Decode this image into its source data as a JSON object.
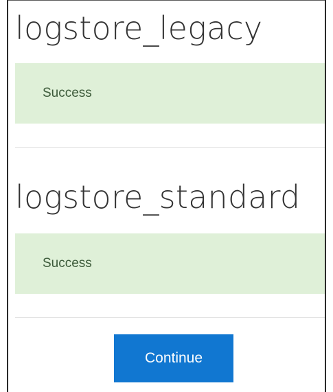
{
  "sections": [
    {
      "title": "logstore_legacy",
      "status": "Success"
    },
    {
      "title": "logstore_standard",
      "status": "Success"
    }
  ],
  "actions": {
    "continue_label": "Continue"
  },
  "colors": {
    "success_background": "#dff0d8",
    "success_text": "#3c5a3a",
    "primary_button": "#1177d1",
    "heading_text": "#333333",
    "divider": "#e3e3e3"
  }
}
